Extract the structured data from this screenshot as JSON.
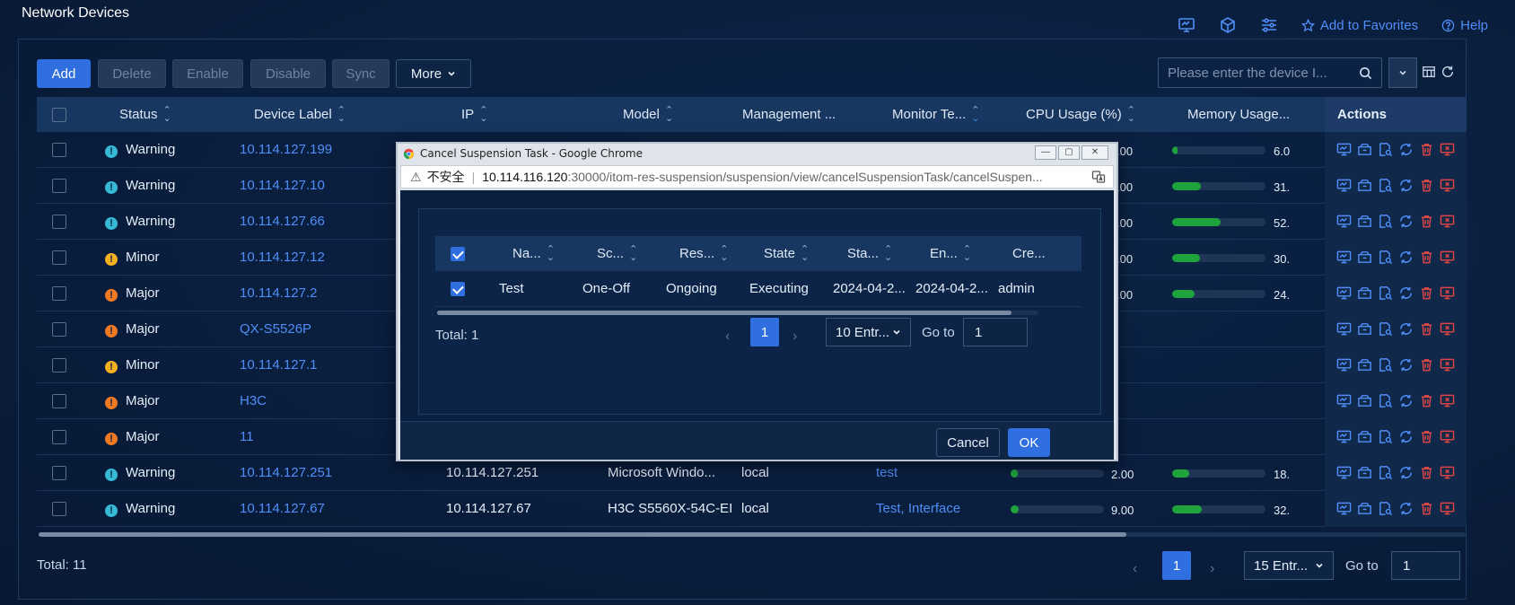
{
  "page": {
    "title": "Network Devices"
  },
  "top_links": {
    "favorites": "Add to Favorites",
    "help": "Help"
  },
  "toolbar": {
    "add": "Add",
    "delete": "Delete",
    "enable": "Enable",
    "disable": "Disable",
    "sync": "Sync",
    "more": "More"
  },
  "search": {
    "placeholder": "Please enter the device I..."
  },
  "table": {
    "headers": {
      "status": "Status",
      "label": "Device Label",
      "ip": "IP",
      "model": "Model",
      "management": "Management ...",
      "monitor": "Monitor Te...",
      "cpu": "CPU Usage (%)",
      "memory": "Memory Usage...",
      "actions": "Actions"
    },
    "rows": [
      {
        "status": "Warning",
        "level": "warning",
        "label": "10.114.127.199",
        "ip": "",
        "model": "",
        "mgmt": "",
        "monitor": "",
        "cpu": "",
        "cpu_pct": null,
        "mem": "6.0",
        "mem_pct": 6
      },
      {
        "status": "Warning",
        "level": "warning",
        "label": "10.114.127.10",
        "ip": "",
        "model": "",
        "mgmt": "",
        "monitor": "",
        "cpu": "",
        "cpu_pct": null,
        "mem": "31.",
        "mem_pct": 31
      },
      {
        "status": "Warning",
        "level": "warning",
        "label": "10.114.127.66",
        "ip": "",
        "model": "",
        "mgmt": "",
        "monitor": "",
        "cpu": "",
        "cpu_pct": null,
        "mem": "52.",
        "mem_pct": 52
      },
      {
        "status": "Minor",
        "level": "minor",
        "label": "10.114.127.12",
        "ip": "",
        "model": "",
        "mgmt": "",
        "monitor": "",
        "cpu": "",
        "cpu_pct": null,
        "mem": "30.",
        "mem_pct": 30
      },
      {
        "status": "Major",
        "level": "major",
        "label": "10.114.127.2",
        "ip": "",
        "model": "",
        "mgmt": "",
        "monitor": "",
        "cpu": "",
        "cpu_pct": null,
        "mem": "24.",
        "mem_pct": 24
      },
      {
        "status": "Major",
        "level": "major",
        "label": "QX-S5526P",
        "ip": "",
        "model": "",
        "mgmt": "",
        "monitor": "",
        "cpu": "",
        "cpu_pct": null,
        "mem": "",
        "mem_pct": null
      },
      {
        "status": "Minor",
        "level": "minor",
        "label": "10.114.127.1",
        "ip": "",
        "model": "",
        "mgmt": "",
        "monitor": "",
        "cpu": "",
        "cpu_pct": null,
        "mem": "",
        "mem_pct": null
      },
      {
        "status": "Major",
        "level": "major",
        "label": "H3C",
        "ip": "",
        "model": "",
        "mgmt": "",
        "monitor": "",
        "cpu": "",
        "cpu_pct": null,
        "mem": "",
        "mem_pct": null
      },
      {
        "status": "Major",
        "level": "major",
        "label": "11",
        "ip": "",
        "model": "",
        "mgmt": "",
        "monitor": "",
        "cpu": "",
        "cpu_pct": null,
        "mem": "",
        "mem_pct": null
      },
      {
        "status": "Warning",
        "level": "warning",
        "label": "10.114.127.251",
        "ip": "10.114.127.251",
        "model": "Microsoft Windo...",
        "mgmt": "local",
        "monitor": "test",
        "cpu": "2.00",
        "cpu_pct": 2,
        "mem": "18.",
        "mem_pct": 18
      },
      {
        "status": "Warning",
        "level": "warning",
        "label": "10.114.127.67",
        "ip": "10.114.127.67",
        "model": "H3C S5560X-54C-EI",
        "mgmt": "local",
        "monitor": "Test, Interface",
        "cpu": "9.00",
        "cpu_pct": 9,
        "mem": "32.",
        "mem_pct": 32
      }
    ],
    "cpu_partial_values": [
      ".00",
      ".00",
      ".00",
      ".00",
      ".00"
    ]
  },
  "pagination": {
    "total": "Total: 11",
    "current": "1",
    "page_size": "15 Entr...",
    "goto_label": "Go to",
    "goto_value": "1"
  },
  "popup": {
    "window_title": "Cancel Suspension Task - Google Chrome",
    "insecure_label": "不安全",
    "url_host": "10.114.116.120",
    "url_path": ":30000/itom-res-suspension/suspension/view/cancelSuspensionTask/cancelSuspen...",
    "headers": {
      "name": "Na...",
      "schedule": "Sc...",
      "result": "Res...",
      "state": "State",
      "start": "Sta...",
      "end": "En...",
      "creator": "Cre..."
    },
    "row": {
      "name": "Test",
      "schedule": "One-Off",
      "result": "Ongoing",
      "state": "Executing",
      "start": "2024-04-2...",
      "end": "2024-04-2...",
      "creator": "admin"
    },
    "pagination": {
      "total": "Total: 1",
      "current": "1",
      "page_size": "10 Entr...",
      "goto_label": "Go to",
      "goto_value": "1"
    },
    "cancel": "Cancel",
    "ok": "OK"
  },
  "colors": {
    "accent": "#2f6fe0",
    "link": "#4f8ff7",
    "warning": "#35b9d6",
    "minor": "#f2b01e",
    "major": "#f07a22",
    "danger": "#e04646",
    "bar_fill": "#1fa33b"
  }
}
